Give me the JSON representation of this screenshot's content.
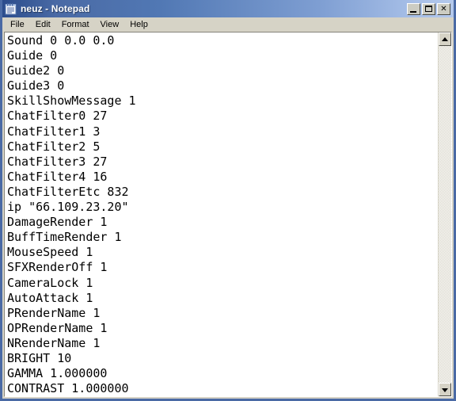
{
  "window": {
    "title": "neuz - Notepad",
    "icon": "notepad-icon",
    "accent_color": "#4a6aa5",
    "face_color": "#d6d3c6"
  },
  "titlebar_buttons": [
    {
      "name": "minimize",
      "label": ""
    },
    {
      "name": "maximize",
      "label": ""
    },
    {
      "name": "close",
      "label": "✕"
    }
  ],
  "menu": {
    "items": [
      {
        "label": "File"
      },
      {
        "label": "Edit"
      },
      {
        "label": "Format"
      },
      {
        "label": "View"
      },
      {
        "label": "Help"
      }
    ]
  },
  "editor": {
    "lines": [
      "Sound 0 0.0 0.0",
      "Guide 0",
      "Guide2 0",
      "Guide3 0",
      "SkillShowMessage 1",
      "ChatFilter0 27",
      "ChatFilter1 3",
      "ChatFilter2 5",
      "ChatFilter3 27",
      "ChatFilter4 16",
      "ChatFilterEtc 832",
      "ip \"66.109.23.20\"",
      "DamageRender 1",
      "BuffTimeRender 1",
      "MouseSpeed 1",
      "SFXRenderOff 1",
      "CameraLock 1",
      "AutoAttack 1",
      "PRenderName 1",
      "OPRenderName 1",
      "NRenderName 1",
      "BRIGHT 10",
      "GAMMA 1.000000",
      "CONTRAST 1.000000"
    ]
  },
  "scrollbar": {
    "up_arrow": "scroll-up-arrow",
    "down_arrow": "scroll-down-arrow"
  }
}
